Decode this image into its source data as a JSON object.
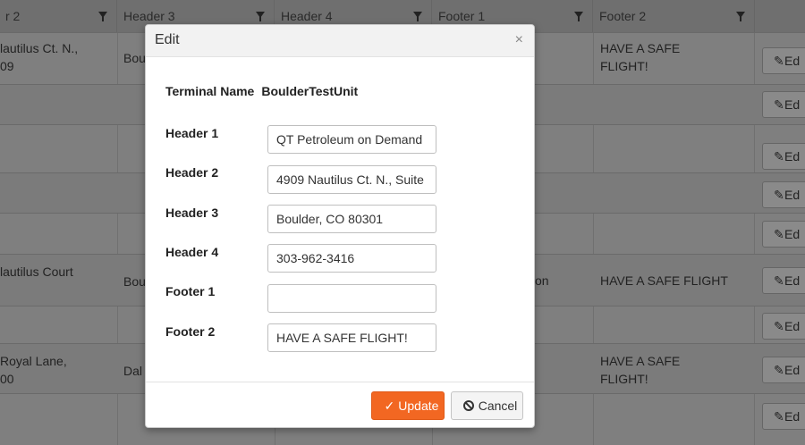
{
  "grid": {
    "headers": [
      {
        "label": "r 2",
        "filter": true
      },
      {
        "label": "Header 3",
        "filter": true
      },
      {
        "label": "Header 4",
        "filter": true
      },
      {
        "label": "Footer 1",
        "filter": true
      },
      {
        "label": "Footer 2",
        "filter": true
      }
    ],
    "rows": [
      {
        "col1_line1": "lautilus Ct. N.,",
        "col1_line2": "09",
        "col2": "Bou",
        "col4": "",
        "col5_line1": "HAVE A SAFE",
        "col5_line2": "FLIGHT!",
        "edit": "Ed"
      },
      {
        "col1_line1": "",
        "col1_line2": "",
        "col2": "",
        "col4": "",
        "col5_line1": "",
        "col5_line2": "",
        "edit": "Ed"
      },
      {
        "col1_line1": "",
        "col1_line2": "",
        "col2": "",
        "col4": "",
        "col5_line1": "",
        "col5_line2": "",
        "edit": "Ed"
      },
      {
        "col1_line1": "",
        "col1_line2": "",
        "col2": "",
        "col4": "",
        "col5_line1": "",
        "col5_line2": "",
        "edit": "Ed"
      },
      {
        "col1_line1": "",
        "col1_line2": "",
        "col2": "",
        "col4": "",
        "col5_line1": "",
        "col5_line2": "",
        "edit": "Ed"
      },
      {
        "col1_line1": "lautilus Court",
        "col1_line2": "",
        "col2": "Bou",
        "col4": "on",
        "col5_line1": "HAVE A SAFE FLIGHT",
        "col5_line2": "",
        "edit": "Ed"
      },
      {
        "col1_line1": "",
        "col1_line2": "",
        "col2": "",
        "col4": "",
        "col5_line1": "",
        "col5_line2": "",
        "edit": "Ed"
      },
      {
        "col1_line1": "Royal Lane,",
        "col1_line2": "00",
        "col2": "Dal",
        "col4": "",
        "col5_line1": "HAVE A SAFE",
        "col5_line2": "FLIGHT!",
        "edit": "Ed"
      },
      {
        "col1_line1": "",
        "col1_line2": "",
        "col2": "",
        "col4": "",
        "col5_line1": "",
        "col5_line2": "",
        "edit": "Ed"
      }
    ]
  },
  "modal": {
    "title": "Edit",
    "close_glyph": "×",
    "terminal_label": "Terminal Name",
    "terminal_value": "BoulderTestUnit",
    "fields": [
      {
        "label": "Header 1",
        "value": "QT Petroleum on Demand"
      },
      {
        "label": "Header 2",
        "value": "4909 Nautilus Ct. N., Suite"
      },
      {
        "label": "Header 3",
        "value": "Boulder, CO 80301"
      },
      {
        "label": "Header 4",
        "value": "303-962-3416"
      },
      {
        "label": "Footer 1",
        "value": ""
      },
      {
        "label": "Footer 2",
        "value": "HAVE A SAFE FLIGHT!"
      }
    ],
    "update_label": "Update",
    "cancel_label": "Cancel"
  },
  "icons": {
    "filter": "filter-icon",
    "pencil": "pencil-icon",
    "check": "check-icon",
    "ban": "ban-icon",
    "close": "close-icon"
  },
  "colors": {
    "primary": "#f26722",
    "overlay": "#7f7f7f"
  }
}
